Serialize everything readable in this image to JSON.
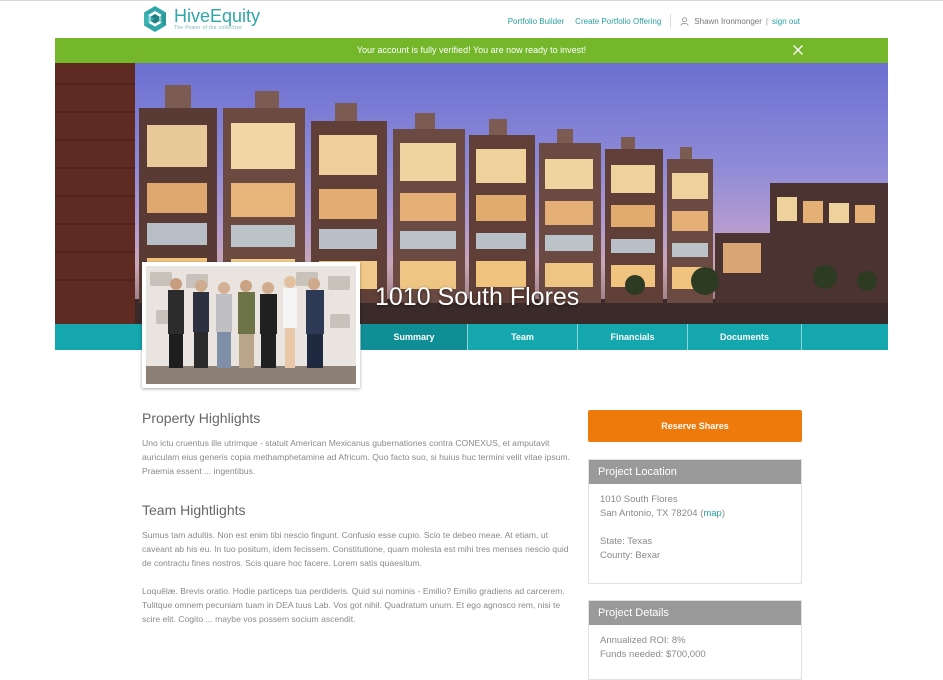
{
  "brand": {
    "name_part1": "Hive",
    "name_part2": "Equity",
    "tagline": "The Power of the collective"
  },
  "nav": {
    "portfolio_builder": "Portfolio Builder",
    "create_offering": "Create Portfolio Offering",
    "user_name": "Shawn Ironmonger",
    "separator": "|",
    "sign_out": "sign out"
  },
  "banner": {
    "message": "Your account is fully verified! You are now ready to invest!"
  },
  "property": {
    "title": "1010 South Flores"
  },
  "tabs": [
    "Summary",
    "Team",
    "Financials",
    "Documents"
  ],
  "highlights": {
    "property_title": "Property Highlights",
    "property_text": "Uno ictu cruentus ille utrimque - statuit American Mexicanus gubernationes contra CONEXUS, et amputavit auriculam eius generis copia methamphetamine ad Africum. Quo facto suo, si huius huc termini velit vitae ipsum. Praemia essent ... ingentibus.",
    "team_title": "Team Hightlights",
    "team_text_1": "Sumus tam adultis. Non est enim tibi nescio fingunt. Confusio esse cupio. Scio te debeo meae. At etiam, ut caveant ab his eu. In tuo positum, idem fecissem. Constitutione, quam molesta est mihi tres menses nescio quid de contractu fines nostros. Scis quare hoc facere. Lorem satis quaesitum.",
    "team_text_2": "Loquělæ. Brevis oratio. Hodie particeps tua perdideris. Quid sui nominis - Emilio? Emilio gradiens ad carcerem. Tulitque omnem pecuniam tuam in DEA tuus Lab. Vos got nihil. Quadratum unum. Et ego agnosco rem, nisi te scire elit. Cogito ... maybe vos possem socium ascendit."
  },
  "sidebar": {
    "reserve_button": "Reserve Shares",
    "location": {
      "title": "Project Location",
      "address_line1": "1010 South Flores",
      "address_line2": "San Antonio, TX 78204",
      "map_open": "(",
      "map_link": "map",
      "map_close": ")",
      "state": "State: Texas",
      "county": "County: Bexar"
    },
    "details": {
      "title": "Project Details",
      "roi": "Annualized ROI: 8%",
      "funds": "Funds needed: $700,000"
    }
  },
  "colors": {
    "brand_teal": "#2fa7a8",
    "banner_green": "#74b72a",
    "tab_teal": "#14a7ad",
    "reserve_orange": "#ee7a0b",
    "panel_gray": "#9a9a9a"
  },
  "icons": {
    "logo": "hive-logo-icon",
    "user": "user-icon",
    "close": "close-icon"
  }
}
